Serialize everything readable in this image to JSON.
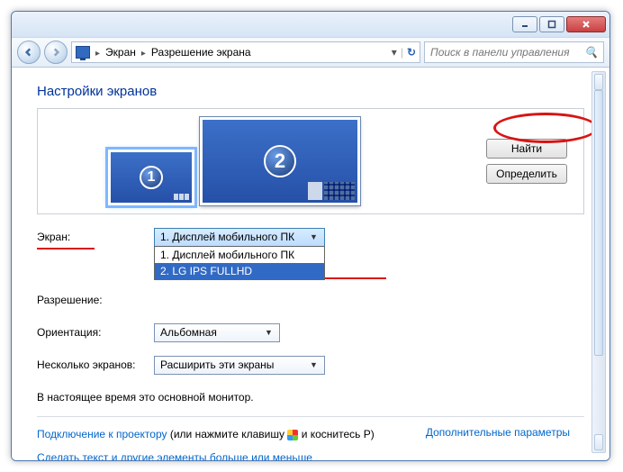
{
  "titlebar": {
    "icons": [
      "minimize",
      "maximize",
      "close"
    ]
  },
  "nav": {
    "breadcrumb": [
      "Экран",
      "Разрешение экрана"
    ],
    "search_placeholder": "Поиск в панели управления"
  },
  "page": {
    "title": "Настройки экранов",
    "buttons": {
      "find": "Найти",
      "identify": "Определить"
    }
  },
  "monitors": [
    {
      "num": "1",
      "selected": true
    },
    {
      "num": "2",
      "selected": false
    }
  ],
  "form": {
    "display_label": "Экран:",
    "display_value": "1. Дисплей мобильного ПК",
    "display_options": [
      "1. Дисплей мобильного ПК",
      "2. LG IPS FULLHD"
    ],
    "resolution_label": "Разрешение:",
    "orientation_label": "Ориентация:",
    "orientation_value": "Альбомная",
    "multi_label": "Несколько экранов:",
    "multi_value": "Расширить эти экраны"
  },
  "notes": {
    "primary": "В настоящее время это основной монитор.",
    "advanced": "Дополнительные параметры",
    "projector_link": "Подключение к проектору",
    "projector_hint_a": " (или нажмите клавишу ",
    "projector_hint_b": " и коснитесь P)",
    "textsize": "Сделать текст и другие элементы больше или меньше"
  }
}
